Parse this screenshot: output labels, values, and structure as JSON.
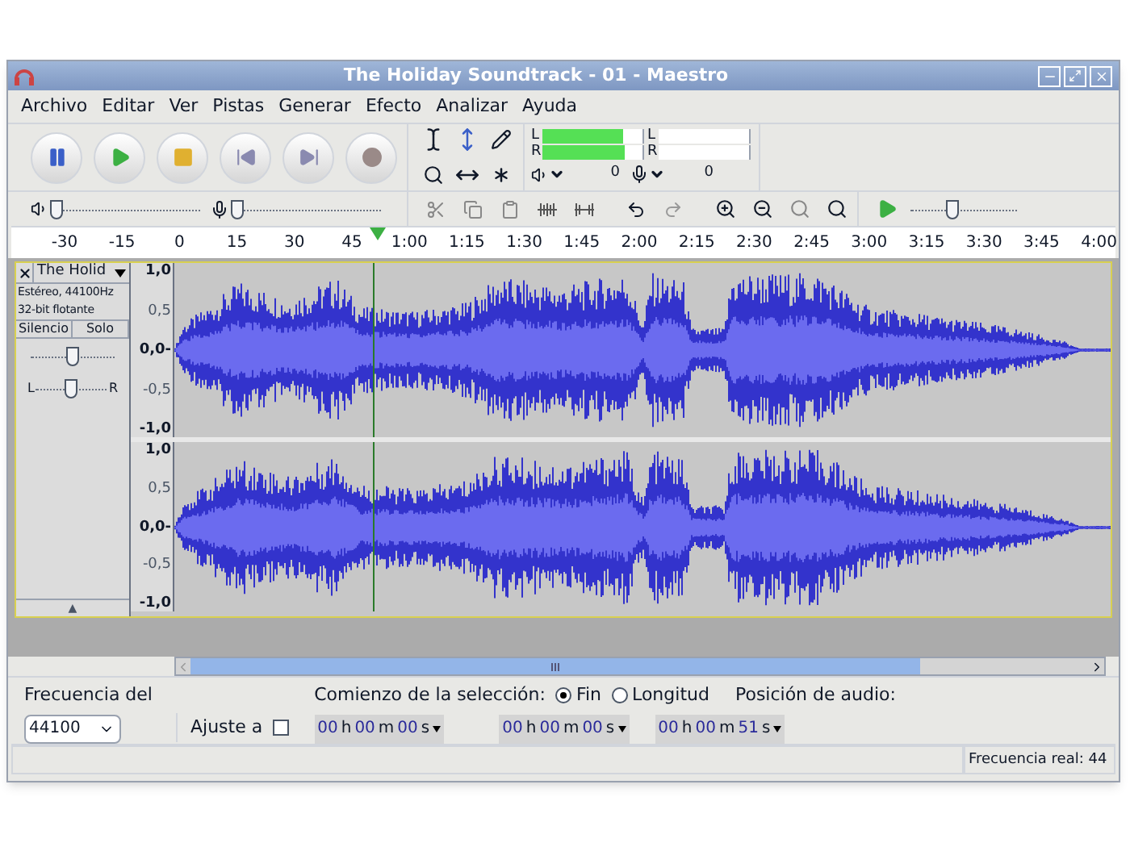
{
  "window": {
    "title": "The Holiday Soundtrack - 01 - Maestro"
  },
  "menu": [
    "Archivo",
    "Editar",
    "Ver",
    "Pistas",
    "Generar",
    "Efecto",
    "Analizar",
    "Ayuda"
  ],
  "meters": {
    "playback": [
      {
        "label": "L",
        "level": 0.8
      },
      {
        "label": "R",
        "level": 0.82
      }
    ],
    "recording": [
      {
        "label": "L",
        "level": 0
      },
      {
        "label": "R",
        "level": 0
      }
    ],
    "playback_reading": "0",
    "recording_reading": "0"
  },
  "mixer": {
    "output": {
      "level": 0.03
    },
    "input": {
      "level": 0.03
    }
  },
  "play_speed": {
    "level": 0.4
  },
  "ruler": [
    "-30",
    "-15",
    "0",
    "15",
    "30",
    "45",
    "1:00",
    "1:15",
    "1:30",
    "1:45",
    "2:00",
    "2:15",
    "2:30",
    "2:45",
    "3:00",
    "3:15",
    "3:30",
    "3:45",
    "4:00"
  ],
  "track": {
    "name": "The Holid",
    "info": [
      "Estéreo, 44100Hz",
      "32-bit flotante"
    ],
    "buttons": [
      {
        "label": "Silencio",
        "on": false
      },
      {
        "label": "Solo",
        "on": false
      }
    ],
    "gain": {
      "level": 0.5
    },
    "pan": {
      "level": 0.5
    },
    "pan_labels": [
      "L",
      "R"
    ],
    "collapse": "▲",
    "channels": [
      {
        "scale": [
          "1,0",
          "0,5",
          "0,0-",
          "-0,5",
          "-1,0"
        ]
      },
      {
        "scale": [
          "1,0",
          "0,5",
          "0,0-",
          "-0,5",
          "-1,0"
        ]
      }
    ]
  },
  "selection_bar": {
    "rate_label": "Frecuencia del",
    "rate": "44100",
    "snap_label": "Ajuste a",
    "snap": false,
    "start_label": "Comienzo de la selección:",
    "modes": [
      {
        "label": "Fin",
        "selected": true
      },
      {
        "label": "Longitud",
        "selected": false
      }
    ],
    "position_label": "Posición de audio:",
    "times": [
      [
        "00",
        "h",
        "00",
        "m",
        "00",
        "s"
      ],
      [
        "00",
        "h",
        "00",
        "m",
        "00",
        "s"
      ],
      [
        "00",
        "h",
        "00",
        "m",
        "51",
        "s"
      ]
    ]
  },
  "status_bar": {
    "rate": "Frecuencia real: 44"
  }
}
